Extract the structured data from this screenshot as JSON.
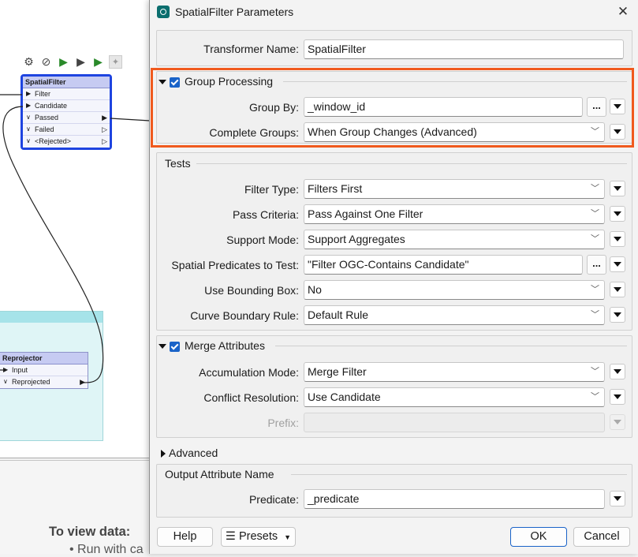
{
  "dialog": {
    "title": "SpatialFilter Parameters",
    "transformer_name_label": "Transformer Name:",
    "transformer_name_value": "SpatialFilter",
    "group_processing": {
      "title": "Group Processing",
      "checked": true,
      "group_by_label": "Group By:",
      "group_by_value": "_window_id",
      "complete_groups_label": "Complete Groups:",
      "complete_groups_value": "When Group Changes (Advanced)"
    },
    "tests": {
      "title": "Tests",
      "fields": [
        {
          "label": "Filter Type:",
          "value": "Filters First"
        },
        {
          "label": "Pass Criteria:",
          "value": "Pass Against One Filter"
        },
        {
          "label": "Support Mode:",
          "value": "Support Aggregates"
        },
        {
          "label": "Spatial Predicates to Test:",
          "value": "\"Filter OGC-Contains Candidate\""
        },
        {
          "label": "Use Bounding Box:",
          "value": "No"
        },
        {
          "label": "Curve Boundary Rule:",
          "value": "Default Rule"
        }
      ]
    },
    "merge_attributes": {
      "title": "Merge Attributes",
      "checked": true,
      "accumulation_mode_label": "Accumulation Mode:",
      "accumulation_mode_value": "Merge Filter",
      "conflict_resolution_label": "Conflict Resolution:",
      "conflict_resolution_value": "Use Candidate",
      "prefix_label": "Prefix:",
      "prefix_value": ""
    },
    "advanced": {
      "title": "Advanced"
    },
    "output": {
      "title": "Output Attribute Name",
      "predicate_label": "Predicate:",
      "predicate_value": "_predicate"
    },
    "buttons": {
      "help": "Help",
      "presets": "Presets",
      "ok": "OK",
      "cancel": "Cancel"
    },
    "dots": "...",
    "highlight_color": "#f05a1e"
  },
  "canvas": {
    "spatial_filter": {
      "title": "SpatialFilter",
      "ports": [
        "Filter",
        "Candidate",
        "Passed",
        "Failed",
        "<Rejected>"
      ]
    },
    "reprojector": {
      "title": "Reprojector",
      "ports": [
        "Input",
        "Reprojected"
      ]
    },
    "node_color": "#c6cbf2",
    "selection_color": "#1e44e0",
    "bookmark_color": "#dff5f6"
  },
  "bottom_pane": {
    "heading": "To view data:",
    "bullet": "Run with ca"
  },
  "icons": [
    "gear-icon",
    "disable-icon",
    "run-to-icon",
    "run-from-icon",
    "run-this-icon",
    "bookmark-icon",
    "chevron-down-icon",
    "close-icon",
    "presets-icon"
  ]
}
